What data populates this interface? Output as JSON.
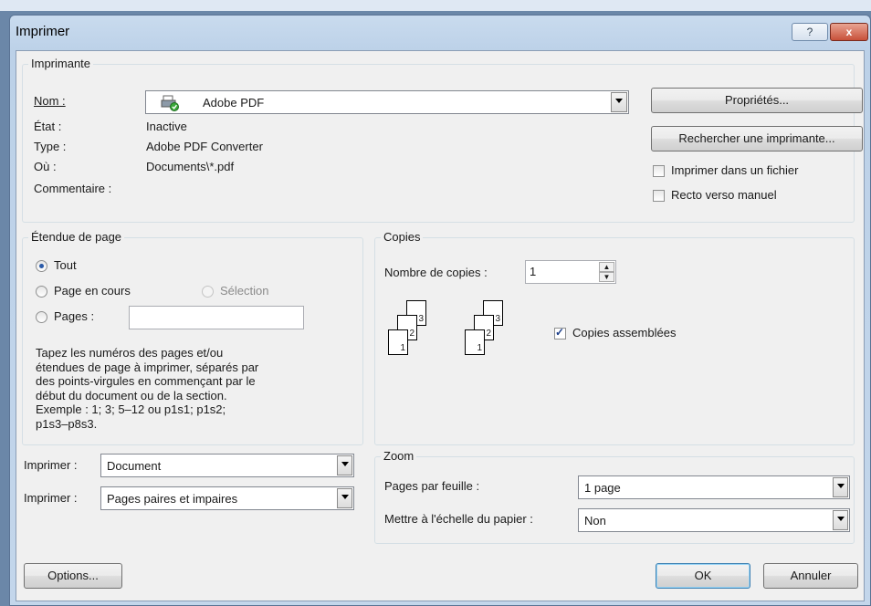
{
  "dialog": {
    "title": "Imprimer",
    "help_label": "?",
    "close_label": "x"
  },
  "printer": {
    "legend": "Imprimante",
    "name_label": "Nom :",
    "name_value": "Adobe PDF",
    "state_label": "État :",
    "state_value": "Inactive",
    "type_label": "Type :",
    "type_value": "Adobe PDF Converter",
    "where_label": "Où :",
    "where_value": "Documents\\*.pdf",
    "comment_label": "Commentaire :",
    "properties_button": "Propriétés...",
    "find_printer_button": "Rechercher une imprimante...",
    "print_to_file_label": "Imprimer dans un fichier",
    "print_to_file_checked": false,
    "manual_duplex_label": "Recto verso manuel",
    "manual_duplex_checked": false
  },
  "page_range": {
    "legend": "Étendue de page",
    "all_label": "Tout",
    "current_page_label": "Page en cours",
    "selection_label": "Sélection",
    "pages_label": "Pages :",
    "pages_value": "",
    "selected": "all",
    "description_lines": [
      "Tapez les numéros des pages et/ou",
      "étendues de page à imprimer, séparés par",
      "des points-virgules en commençant par le",
      "début du document ou de la section.",
      "Exemple : 1; 3; 5–12 ou p1s1; p1s2;",
      "p1s3–p8s3."
    ]
  },
  "copies": {
    "legend": "Copies",
    "count_label": "Nombre de copies :",
    "count_value": "1",
    "collate_label": "Copies assemblées",
    "collate_checked": true,
    "page_numbers": [
      "3",
      "2",
      "1"
    ]
  },
  "print_what": {
    "label1": "Imprimer :",
    "value1": "Document",
    "label2": "Imprimer :",
    "value2": "Pages paires et impaires"
  },
  "zoom": {
    "legend": "Zoom",
    "pages_per_sheet_label": "Pages par feuille :",
    "pages_per_sheet_value": "1 page",
    "scale_label": "Mettre à l'échelle du papier :",
    "scale_value": "Non"
  },
  "footer": {
    "options_button": "Options...",
    "ok_button": "OK",
    "cancel_button": "Annuler"
  }
}
